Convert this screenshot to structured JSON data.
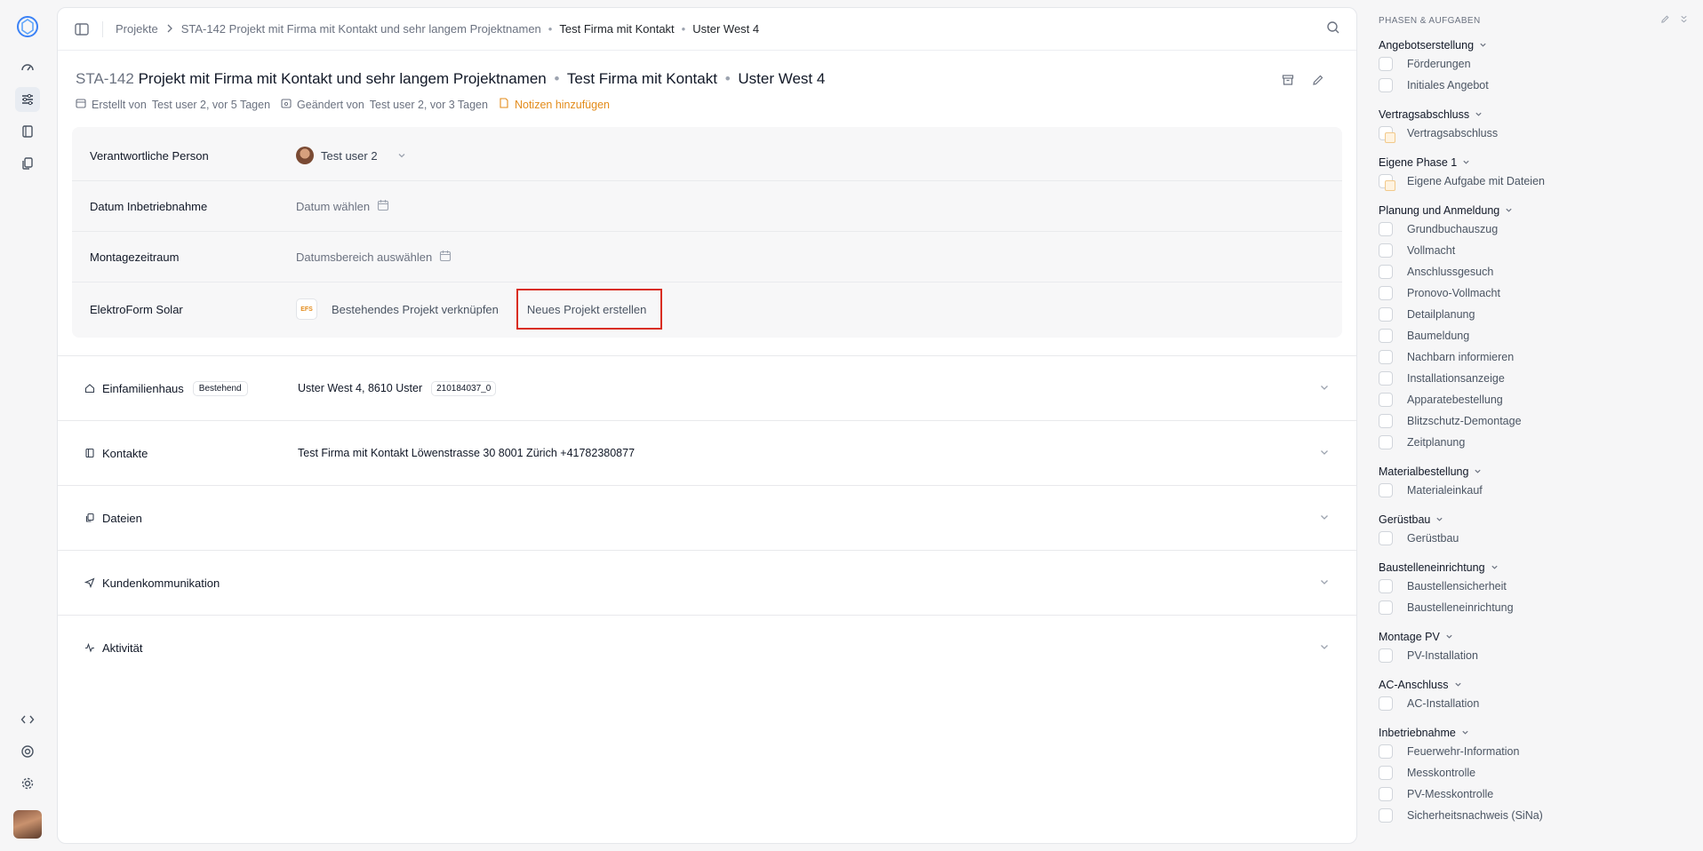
{
  "breadcrumb": {
    "root": "Projekte",
    "project": "STA-142 Projekt mit Firma mit Kontakt und sehr langem Projektnamen",
    "company": "Test Firma mit Kontakt",
    "location": "Uster West 4"
  },
  "header": {
    "code": "STA-142",
    "name": "Projekt mit Firma mit Kontakt und sehr langem Projektnamen",
    "company": "Test Firma mit Kontakt",
    "location": "Uster West 4",
    "created_label": "Erstellt von",
    "created_value": "Test user 2, vor 5 Tagen",
    "changed_label": "Geändert von",
    "changed_value": "Test user 2, vor 3 Tagen",
    "notes_link": "Notizen hinzufügen"
  },
  "properties": {
    "responsible_label": "Verantwortliche Person",
    "responsible_value": "Test user 2",
    "commissioning_label": "Datum Inbetriebnahme",
    "commissioning_value": "Datum wählen",
    "assembly_label": "Montagezeitraum",
    "assembly_value": "Datumsbereich auswählen",
    "integration_label": "ElektroForm Solar",
    "integration_logo": "EFS",
    "link_existing": "Bestehendes Projekt verknüpfen",
    "create_new": "Neues Projekt erstellen"
  },
  "sections": {
    "house_label": "Einfamilienhaus",
    "house_badge": "Bestehend",
    "house_address": "Uster West 4, 8610 Uster",
    "house_code": "210184037_0",
    "contacts_label": "Kontakte",
    "contacts_value": "Test Firma mit Kontakt Löwenstrasse 30 8001 Zürich +41782380877",
    "files_label": "Dateien",
    "communication_label": "Kundenkommunikation",
    "activity_label": "Aktivität"
  },
  "sidebar": {
    "title": "PHASEN & AUFGABEN",
    "phases": [
      {
        "title": "Angebotserstellung",
        "tasks": [
          {
            "label": "Förderungen",
            "link": false
          },
          {
            "label": "Initiales Angebot",
            "link": false
          }
        ]
      },
      {
        "title": "Vertragsabschluss",
        "tasks": [
          {
            "label": "Vertragsabschluss",
            "link": true
          }
        ]
      },
      {
        "title": "Eigene Phase 1",
        "tasks": [
          {
            "label": "Eigene Aufgabe mit Dateien",
            "link": true
          }
        ]
      },
      {
        "title": "Planung und Anmeldung",
        "tasks": [
          {
            "label": "Grundbuchauszug",
            "link": false
          },
          {
            "label": "Vollmacht",
            "link": false
          },
          {
            "label": "Anschlussgesuch",
            "link": false
          },
          {
            "label": "Pronovo-Vollmacht",
            "link": false
          },
          {
            "label": "Detailplanung",
            "link": false
          },
          {
            "label": "Baumeldung",
            "link": false
          },
          {
            "label": "Nachbarn informieren",
            "link": false
          },
          {
            "label": "Installationsanzeige",
            "link": false
          },
          {
            "label": "Apparatebestellung",
            "link": false
          },
          {
            "label": "Blitzschutz-Demontage",
            "link": false
          },
          {
            "label": "Zeitplanung",
            "link": false
          }
        ]
      },
      {
        "title": "Materialbestellung",
        "tasks": [
          {
            "label": "Materialeinkauf",
            "link": false
          }
        ]
      },
      {
        "title": "Gerüstbau",
        "tasks": [
          {
            "label": "Gerüstbau",
            "link": false
          }
        ]
      },
      {
        "title": "Baustelleneinrichtung",
        "tasks": [
          {
            "label": "Baustellensicherheit",
            "link": false
          },
          {
            "label": "Baustelleneinrichtung",
            "link": false
          }
        ]
      },
      {
        "title": "Montage PV",
        "tasks": [
          {
            "label": "PV-Installation",
            "link": false
          }
        ]
      },
      {
        "title": "AC-Anschluss",
        "tasks": [
          {
            "label": "AC-Installation",
            "link": false
          }
        ]
      },
      {
        "title": "Inbetriebnahme",
        "tasks": [
          {
            "label": "Feuerwehr-Information",
            "link": false
          },
          {
            "label": "Messkontrolle",
            "link": false
          },
          {
            "label": "PV-Messkontrolle",
            "link": false
          },
          {
            "label": "Sicherheitsnachweis (SiNa)",
            "link": false
          }
        ]
      }
    ]
  }
}
